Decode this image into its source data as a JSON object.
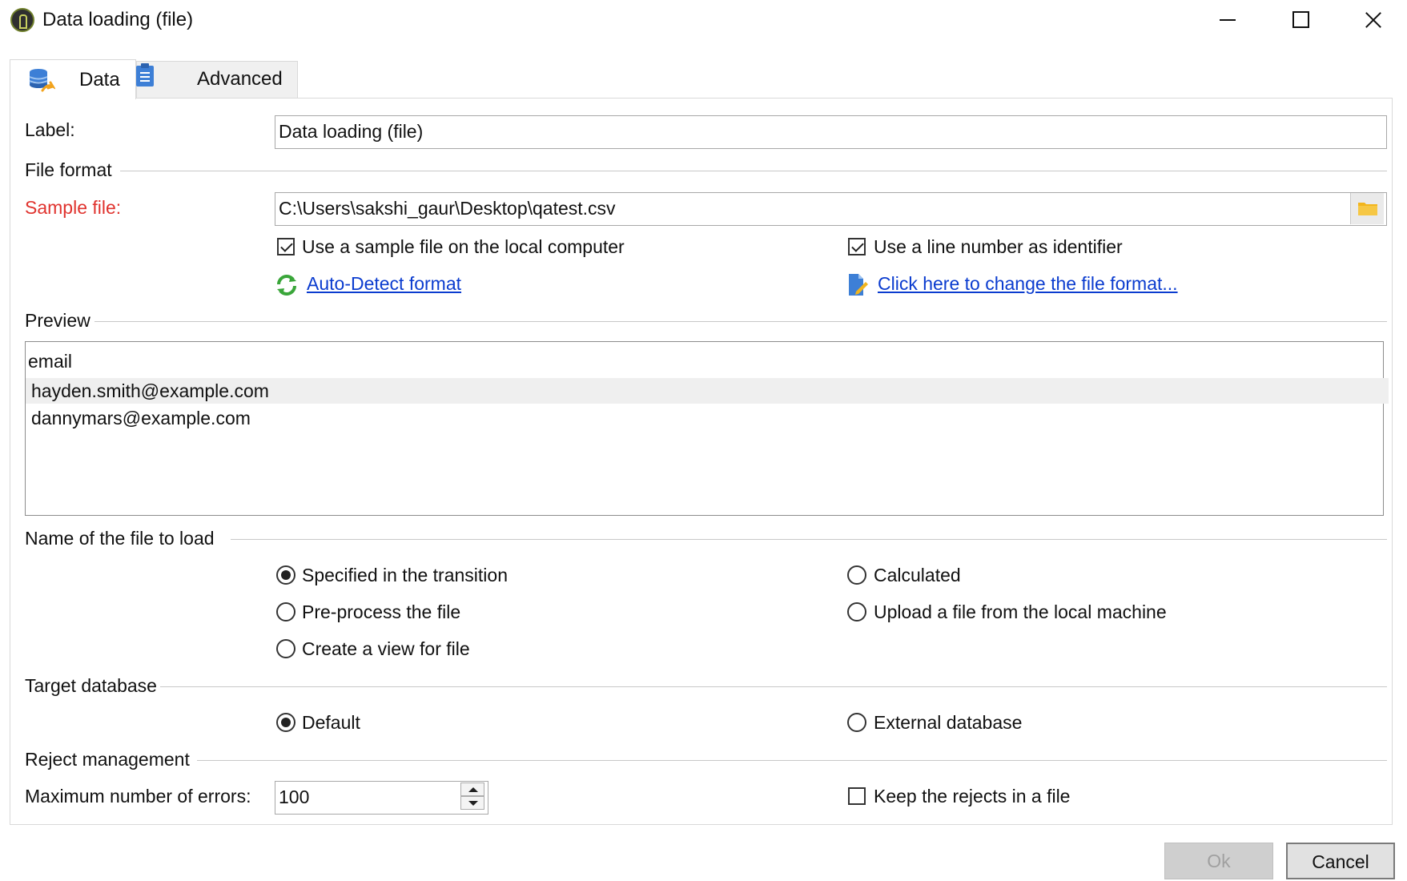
{
  "window": {
    "title": "Data loading (file)"
  },
  "tabs": [
    {
      "label": "Data",
      "icon": "database-icon",
      "active": true
    },
    {
      "label": "Advanced",
      "icon": "clipboard-icon",
      "active": false
    }
  ],
  "form": {
    "label_caption": "Label:",
    "label_value": "Data loading (file)",
    "file_format_group": "File format",
    "sample_file_caption": "Sample file:",
    "sample_file_value": "C:\\Users\\sakshi_gaur\\Desktop\\qatest.csv",
    "use_sample_file": {
      "label": "Use a sample file on the local computer",
      "checked": true
    },
    "use_line_number": {
      "label": "Use a line number as identifier",
      "checked": true
    },
    "auto_detect_link": "Auto-Detect format",
    "change_format_link": "Click here to change the file format..."
  },
  "preview": {
    "group": "Preview",
    "header": "email",
    "rows": [
      "hayden.smith@example.com",
      "dannymars@example.com"
    ],
    "selected_row": 0
  },
  "file_to_load": {
    "group": "Name of the file to load",
    "options": [
      {
        "label": "Specified in the transition",
        "selected": true
      },
      {
        "label": "Calculated",
        "selected": false
      },
      {
        "label": "Pre-process the file",
        "selected": false
      },
      {
        "label": "Upload a file from the local machine",
        "selected": false
      },
      {
        "label": "Create a view for file",
        "selected": false
      }
    ]
  },
  "target_database": {
    "group": "Target database",
    "options": [
      {
        "label": "Default",
        "selected": true
      },
      {
        "label": "External database",
        "selected": false
      }
    ]
  },
  "reject": {
    "group": "Reject management",
    "max_errors_caption": "Maximum number of errors:",
    "max_errors_value": "100",
    "keep_rejects": {
      "label": "Keep the rejects in a file",
      "checked": false
    }
  },
  "buttons": {
    "ok": "Ok",
    "cancel": "Cancel"
  },
  "colors": {
    "required_label": "#e0332e",
    "link": "#0b3ccf",
    "folder": "#f2b51d"
  }
}
